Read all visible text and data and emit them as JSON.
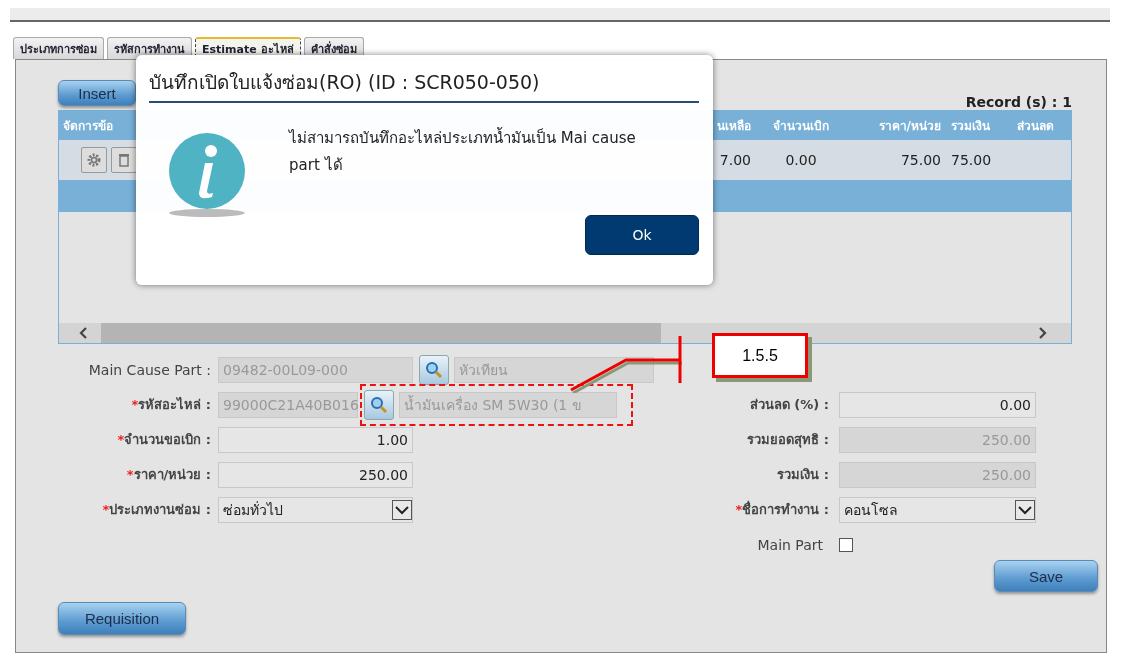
{
  "tabs": [
    {
      "label": "ประเภทการซ่อม",
      "selected": false
    },
    {
      "label": "รหัสการทำงาน",
      "selected": false
    },
    {
      "label": "Estimate อะไหล่",
      "selected": true
    },
    {
      "label": "คำสั่งซ่อม",
      "selected": false
    }
  ],
  "insert_button": "Insert",
  "record_count": "Record (s) : 1",
  "table": {
    "columns": [
      "จัดการข้อ",
      "นเหลือ",
      "จำนวนเบิก",
      "ราคา/หน่วย",
      "รวมเงิน",
      "ส่วนลด"
    ],
    "rows": [
      {
        "values": [
          "7.00",
          "0.00",
          "75.00",
          "75.00"
        ]
      }
    ]
  },
  "form_left": [
    {
      "label": "Main Cause Part :",
      "kind": "lookup",
      "value": "09482-00L09-000",
      "name": "หัวเทียน",
      "disabled": true
    },
    {
      "mark": "*",
      "label": "รหัสอะไหล่ :",
      "kind": "lookup",
      "value": "99000C21A40B016",
      "name": "น้ำมันเครื่อง SM 5W30 (1 ข",
      "disabled": true,
      "highlighted": true
    },
    {
      "mark": "*",
      "label": "จำนวนขอเบิก :",
      "kind": "input",
      "value": "1.00",
      "disabled": false
    },
    {
      "mark": "*",
      "label": "ราคา/หน่วย :",
      "kind": "input",
      "value": "250.00",
      "disabled": false
    },
    {
      "mark": "*",
      "label": "ประเภทงานซ่อม :",
      "kind": "select",
      "value": "ซ่อมทั่วไป",
      "disabled": false
    }
  ],
  "form_right": [
    {
      "label": "ส่วนลด (%) :",
      "kind": "input",
      "value": "0.00",
      "disabled": false
    },
    {
      "label": "รวมยอดสุทธิ :",
      "kind": "input",
      "value": "250.00",
      "disabled": true
    },
    {
      "label": "รวมเงิน :",
      "kind": "input",
      "value": "250.00",
      "disabled": true
    },
    {
      "mark": "*",
      "label": "ชื่อการทำงาน :",
      "kind": "select",
      "value": "คอนโซล",
      "disabled": false
    },
    {
      "label": "Main Part",
      "kind": "checkbox",
      "checked": false
    }
  ],
  "save_button": "Save",
  "requisition_button": "Requisition",
  "callout": "1.5.5",
  "dialog": {
    "title": "บันทึกเปิดใบแจ้งซ่อม(RO) (ID : SCR050-050)",
    "message": "ไม่สามารถบันทึกอะไหล่ประเภทน้ำมันเป็น Mai cause part ได้",
    "button": "Ok"
  }
}
